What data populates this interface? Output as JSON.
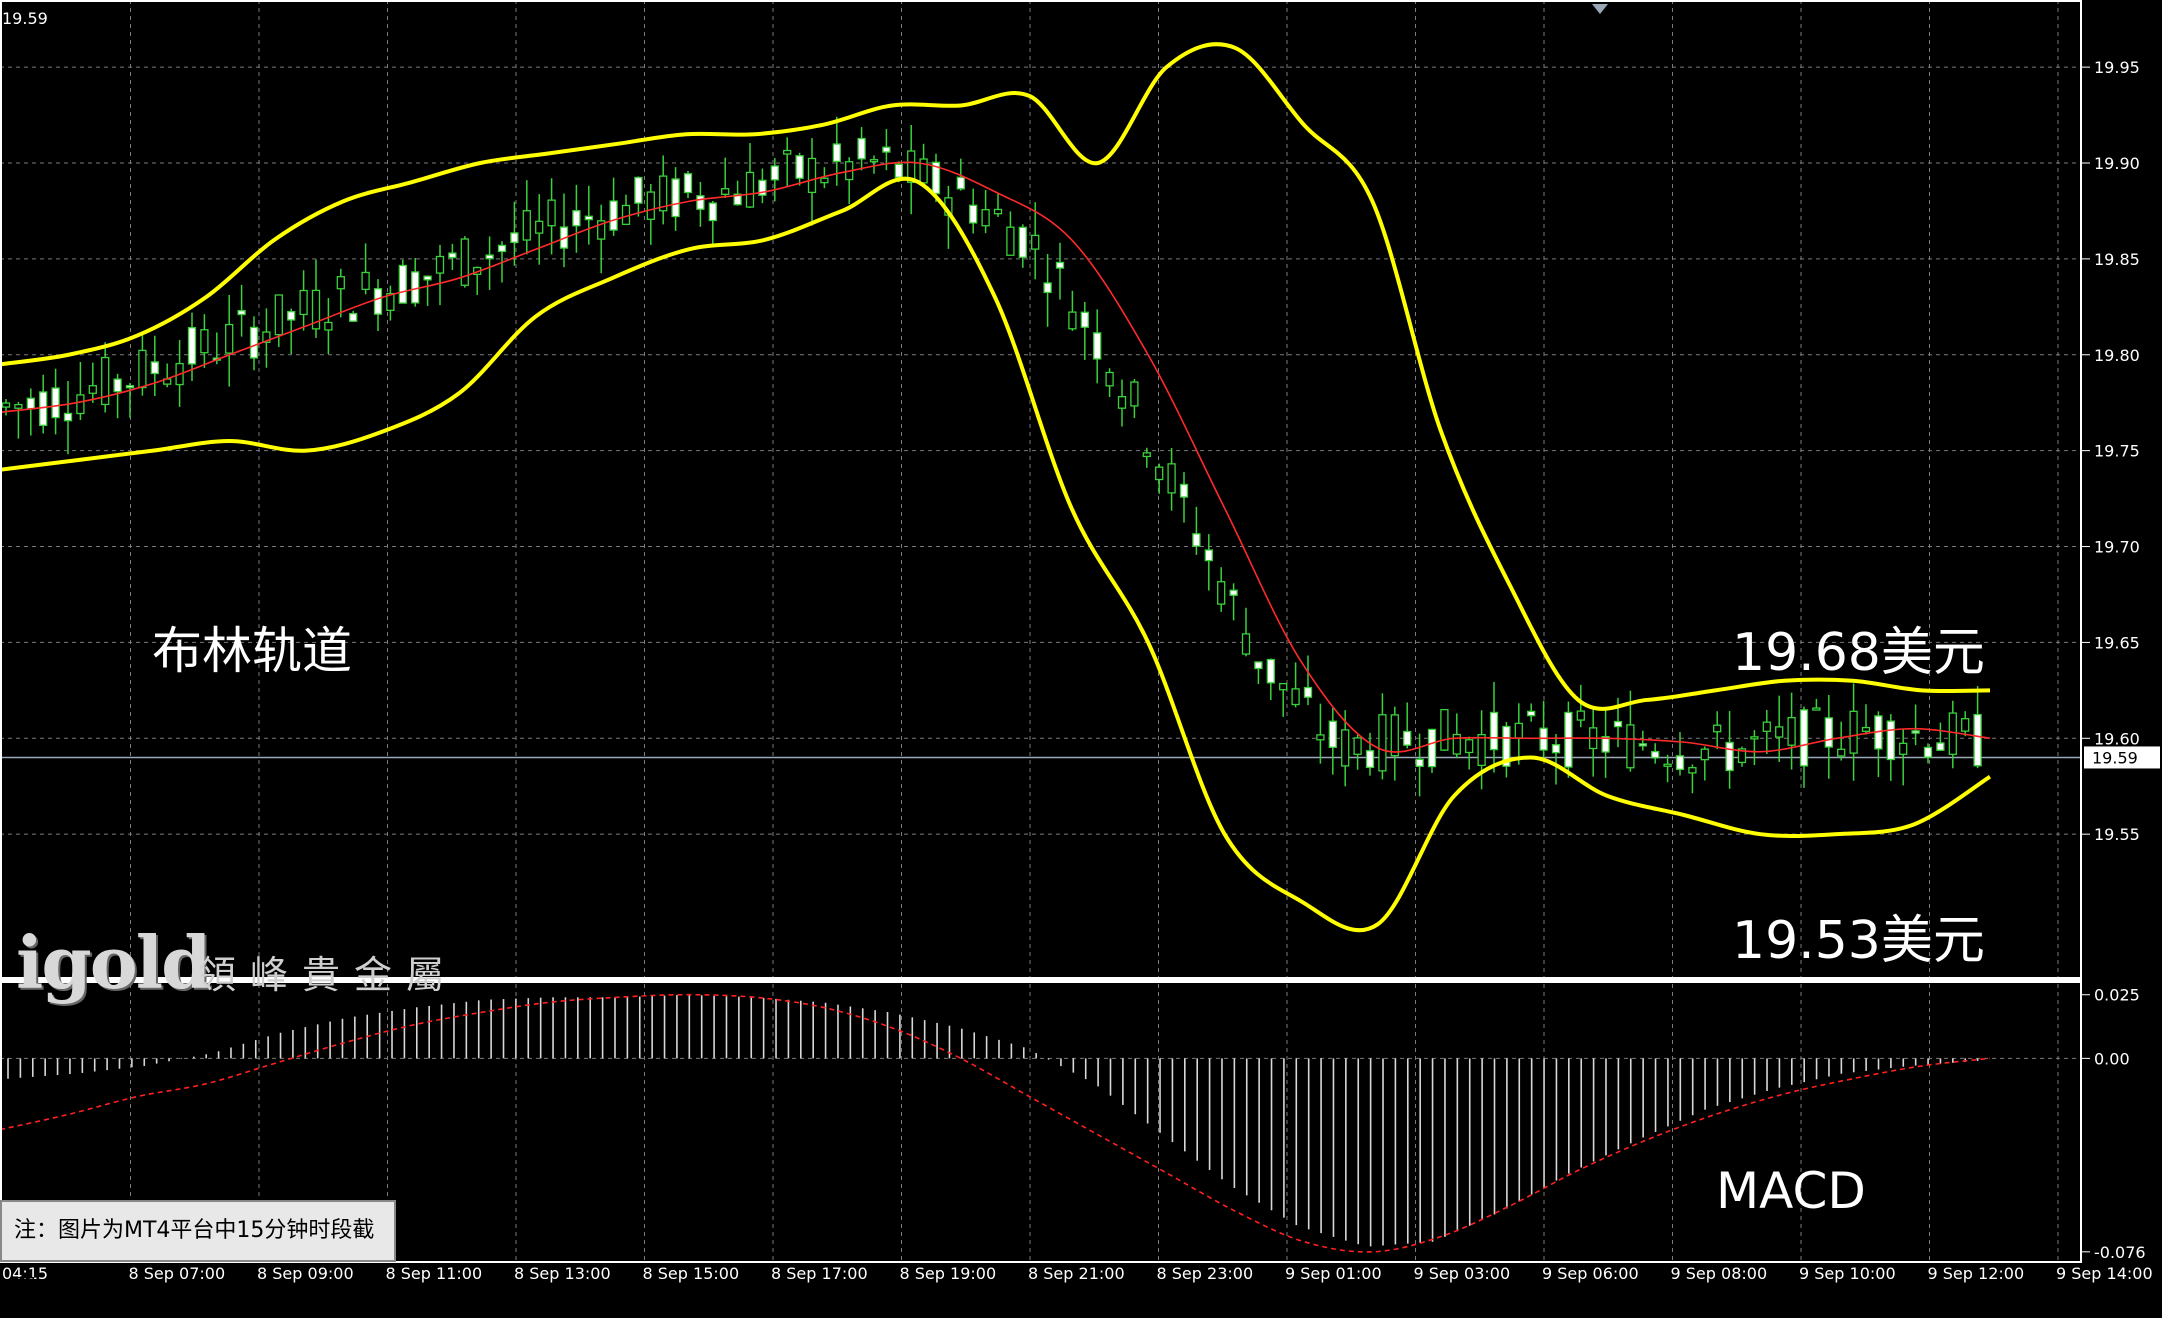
{
  "chart_data": {
    "type": "line",
    "instrument_top_left": "19.59",
    "labels": {
      "bollinger": "布林轨道",
      "upper_price": "19.68美元",
      "lower_price": "19.53美元",
      "macd": "MACD"
    },
    "price_axis": {
      "ticks": [
        "19.95",
        "19.90",
        "19.85",
        "19.80",
        "19.75",
        "19.70",
        "19.65",
        "19.60",
        "19.55"
      ],
      "current": "19.59",
      "ylim": [
        19.475,
        19.985
      ]
    },
    "macd_axis": {
      "ticks": [
        "0.025",
        "0.00",
        "-0.076"
      ],
      "ylim": [
        -0.08,
        0.03
      ]
    },
    "x_ticks": [
      "04:15",
      "8 Sep 07:00",
      "8 Sep 09:00",
      "8 Sep 11:00",
      "8 Sep 13:00",
      "8 Sep 15:00",
      "8 Sep 17:00",
      "8 Sep 19:00",
      "8 Sep 21:00",
      "8 Sep 23:00",
      "9 Sep 01:00",
      "9 Sep 03:00",
      "9 Sep 06:00",
      "9 Sep 08:00",
      "9 Sep 10:00",
      "9 Sep 12:00",
      "9 Sep 14:00"
    ],
    "series": [
      {
        "name": "upper",
        "color": "#ffff00",
        "values": [
          19.795,
          19.8,
          19.81,
          19.83,
          19.86,
          19.88,
          19.89,
          19.9,
          19.905,
          19.91,
          19.915,
          19.915,
          19.92,
          19.93,
          19.93,
          19.935,
          19.9,
          19.95,
          19.96,
          19.92,
          19.88,
          19.76,
          19.68,
          19.62,
          19.62,
          19.625,
          19.63,
          19.63,
          19.625,
          19.625
        ]
      },
      {
        "name": "middle",
        "color": "#ff2a2a",
        "values": [
          19.77,
          19.775,
          19.785,
          19.8,
          19.815,
          19.83,
          19.84,
          19.855,
          19.87,
          19.88,
          19.885,
          19.895,
          19.9,
          19.885,
          19.86,
          19.8,
          19.72,
          19.64,
          19.595,
          19.6,
          19.6,
          19.6,
          19.598,
          19.593,
          19.6,
          19.605,
          19.6
        ]
      },
      {
        "name": "lower",
        "color": "#ffff00",
        "values": [
          19.74,
          19.745,
          19.75,
          19.755,
          19.75,
          19.76,
          19.78,
          19.82,
          19.84,
          19.855,
          19.86,
          19.875,
          19.89,
          19.83,
          19.72,
          19.65,
          19.55,
          19.515,
          19.503,
          19.57,
          19.59,
          19.57,
          19.56,
          19.55,
          19.55,
          19.555,
          19.58
        ]
      }
    ],
    "macd_histogram": [
      -0.008,
      -0.006,
      -0.003,
      0.002,
      0.01,
      0.016,
      0.02,
      0.023,
      0.024,
      0.024,
      0.025,
      0.024,
      0.022,
      0.018,
      0.012,
      0.004,
      -0.01,
      -0.03,
      -0.05,
      -0.066,
      -0.074,
      -0.072,
      -0.06,
      -0.045,
      -0.032,
      -0.02,
      -0.012,
      -0.006,
      -0.003,
      -0.001
    ],
    "macd_signal": [
      -0.028,
      -0.022,
      -0.015,
      -0.01,
      -0.002,
      0.006,
      0.013,
      0.018,
      0.022,
      0.024,
      0.025,
      0.024,
      0.02,
      0.012,
      0.0,
      -0.015,
      -0.03,
      -0.045,
      -0.06,
      -0.072,
      -0.076,
      -0.07,
      -0.058,
      -0.044,
      -0.032,
      -0.022,
      -0.014,
      -0.008,
      -0.003,
      0.0
    ]
  },
  "note": "注：图片为MT4平台中15分钟时段截图",
  "logo": {
    "text": "igold",
    "cn": "領峰貴金屬"
  }
}
